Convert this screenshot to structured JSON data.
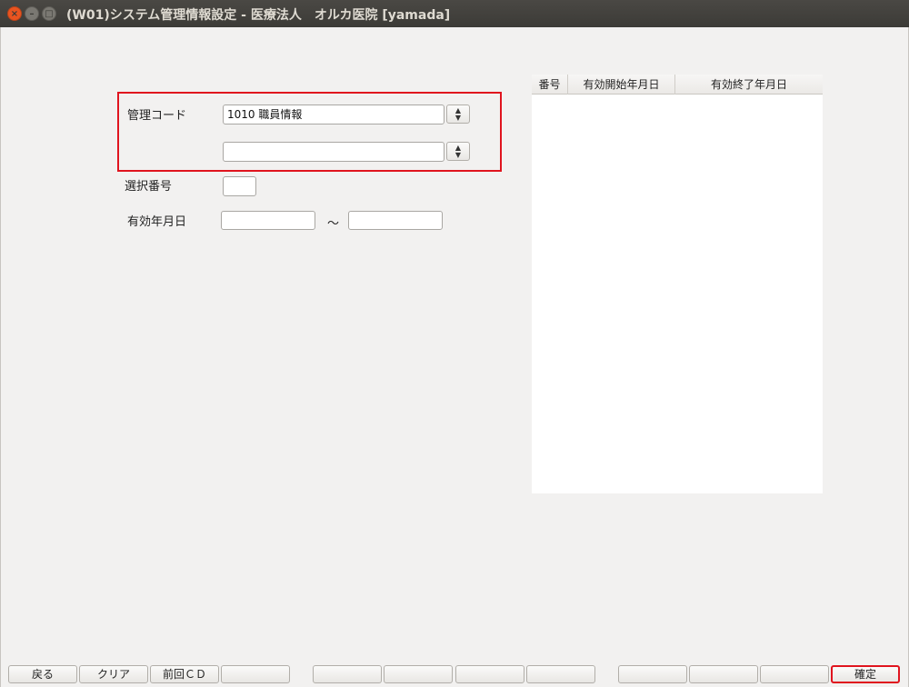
{
  "window": {
    "title": "(W01)システム管理情報設定 - 医療法人　オルカ医院  [yamada]",
    "close_glyph": "×",
    "min_glyph": "–",
    "max_glyph": "□"
  },
  "form": {
    "management_code_label": "管理コード",
    "management_code_value": "1010 職員情報",
    "management_code_sub_value": "",
    "selection_number_label": "選択番号",
    "selection_number_value": "",
    "valid_date_label": "有効年月日",
    "valid_date_from": "",
    "valid_date_tilde": "～",
    "valid_date_to": "",
    "spin_glyph": "▴\n▾"
  },
  "table": {
    "columns": [
      "番号",
      "有効開始年月日",
      "有効終了年月日"
    ],
    "rows": []
  },
  "function_keys": [
    {
      "label": "戻る"
    },
    {
      "label": "クリア"
    },
    {
      "label": "前回ＣＤ"
    },
    {
      "label": ""
    },
    {
      "label": ""
    },
    {
      "label": ""
    },
    {
      "label": ""
    },
    {
      "label": ""
    },
    {
      "label": ""
    },
    {
      "label": ""
    },
    {
      "label": ""
    },
    {
      "label": "確定"
    }
  ],
  "colors": {
    "highlight": "#e0141e",
    "titlebar": "#3c3b37",
    "close_button": "#e95420"
  }
}
